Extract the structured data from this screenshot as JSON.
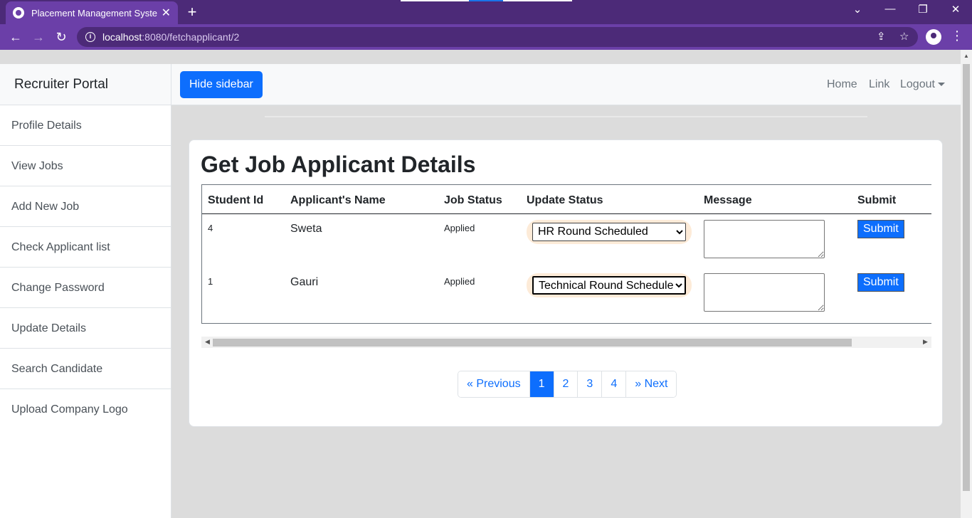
{
  "browser": {
    "tab_title": "Placement Management System",
    "tab_close": "✕",
    "new_tab": "+",
    "url_host": "localhost",
    "url_path": ":8080/fetchapplicant/2"
  },
  "sidebar": {
    "heading": "Recruiter Portal",
    "items": [
      {
        "label": "Profile Details"
      },
      {
        "label": "View Jobs"
      },
      {
        "label": "Add New Job"
      },
      {
        "label": "Check Applicant list"
      },
      {
        "label": "Change Password"
      },
      {
        "label": "Update Details"
      },
      {
        "label": "Search Candidate"
      },
      {
        "label": "Upload Company Logo"
      }
    ]
  },
  "navbar": {
    "toggle_label": "Hide sidebar",
    "links": {
      "home": "Home",
      "link": "Link",
      "logout": "Logout"
    }
  },
  "main": {
    "title": "Get Job Applicant Details",
    "columns": [
      "Student Id",
      "Applicant's Name",
      "Job Status",
      "Update Status",
      "Message",
      "Submit"
    ],
    "rows": [
      {
        "id": "4",
        "name": "Sweta",
        "status": "Applied",
        "update": "HR Round Scheduled",
        "submit": "Submit"
      },
      {
        "id": "1",
        "name": "Gauri",
        "status": "Applied",
        "update": "Technical Round Scheduled",
        "submit": "Submit"
      }
    ]
  },
  "pagination": {
    "previous": "« Previous",
    "pages": [
      "1",
      "2",
      "3",
      "4"
    ],
    "next": "» Next",
    "active_page": "1"
  },
  "colors": {
    "browser_frame": "#4c2a78",
    "primary": "#0d6efd",
    "select_highlight": "#fdebd8"
  }
}
